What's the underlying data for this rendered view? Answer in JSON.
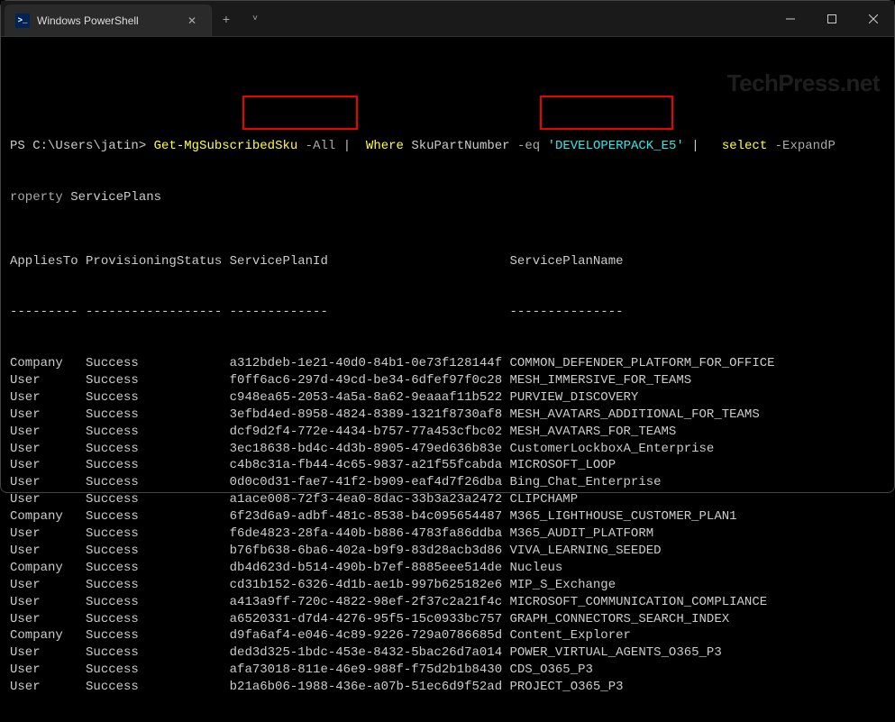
{
  "window": {
    "tab_title": "Windows PowerShell"
  },
  "watermark": "TechPress.net",
  "prompt": {
    "ps": "PS ",
    "path": "C:\\Users\\jatin> ",
    "cmd1": "Get-MgSubscribedSku",
    "flag_all": " -All ",
    "pipe1": "|",
    "where": "  Where ",
    "sku": "SkuPartNumber",
    "eq": " -eq ",
    "val": "'DEVELOPERPACK_E5'",
    "pipe2": " | ",
    "select": "  select ",
    "expand": "-ExpandP",
    "roperty": "roperty ",
    "sp": "ServicePlans"
  },
  "columns": {
    "c1": "AppliesTo",
    "c2": "ProvisioningStatus",
    "c3": "ServicePlanId",
    "c4": "ServicePlanName"
  },
  "dividers": {
    "c1": "---------",
    "c2": "------------------",
    "c3": "-------------",
    "c4": "---------------"
  },
  "rows": [
    {
      "applies": "Company",
      "status": "Success",
      "id": "a312bdeb-1e21-40d0-84b1-0e73f128144f",
      "name": "COMMON_DEFENDER_PLATFORM_FOR_OFFICE"
    },
    {
      "applies": "User",
      "status": "Success",
      "id": "f0ff6ac6-297d-49cd-be34-6dfef97f0c28",
      "name": "MESH_IMMERSIVE_FOR_TEAMS"
    },
    {
      "applies": "User",
      "status": "Success",
      "id": "c948ea65-2053-4a5a-8a62-9eaaaf11b522",
      "name": "PURVIEW_DISCOVERY"
    },
    {
      "applies": "User",
      "status": "Success",
      "id": "3efbd4ed-8958-4824-8389-1321f8730af8",
      "name": "MESH_AVATARS_ADDITIONAL_FOR_TEAMS"
    },
    {
      "applies": "User",
      "status": "Success",
      "id": "dcf9d2f4-772e-4434-b757-77a453cfbc02",
      "name": "MESH_AVATARS_FOR_TEAMS"
    },
    {
      "applies": "User",
      "status": "Success",
      "id": "3ec18638-bd4c-4d3b-8905-479ed636b83e",
      "name": "CustomerLockboxA_Enterprise"
    },
    {
      "applies": "User",
      "status": "Success",
      "id": "c4b8c31a-fb44-4c65-9837-a21f55fcabda",
      "name": "MICROSOFT_LOOP"
    },
    {
      "applies": "User",
      "status": "Success",
      "id": "0d0c0d31-fae7-41f2-b909-eaf4d7f26dba",
      "name": "Bing_Chat_Enterprise"
    },
    {
      "applies": "User",
      "status": "Success",
      "id": "a1ace008-72f3-4ea0-8dac-33b3a23a2472",
      "name": "CLIPCHAMP"
    },
    {
      "applies": "Company",
      "status": "Success",
      "id": "6f23d6a9-adbf-481c-8538-b4c095654487",
      "name": "M365_LIGHTHOUSE_CUSTOMER_PLAN1"
    },
    {
      "applies": "User",
      "status": "Success",
      "id": "f6de4823-28fa-440b-b886-4783fa86ddba",
      "name": "M365_AUDIT_PLATFORM"
    },
    {
      "applies": "User",
      "status": "Success",
      "id": "b76fb638-6ba6-402a-b9f9-83d28acb3d86",
      "name": "VIVA_LEARNING_SEEDED"
    },
    {
      "applies": "Company",
      "status": "Success",
      "id": "db4d623d-b514-490b-b7ef-8885eee514de",
      "name": "Nucleus"
    },
    {
      "applies": "User",
      "status": "Success",
      "id": "cd31b152-6326-4d1b-ae1b-997b625182e6",
      "name": "MIP_S_Exchange"
    },
    {
      "applies": "User",
      "status": "Success",
      "id": "a413a9ff-720c-4822-98ef-2f37c2a21f4c",
      "name": "MICROSOFT_COMMUNICATION_COMPLIANCE"
    },
    {
      "applies": "User",
      "status": "Success",
      "id": "a6520331-d7d4-4276-95f5-15c0933bc757",
      "name": "GRAPH_CONNECTORS_SEARCH_INDEX"
    },
    {
      "applies": "Company",
      "status": "Success",
      "id": "d9fa6af4-e046-4c89-9226-729a0786685d",
      "name": "Content_Explorer"
    },
    {
      "applies": "User",
      "status": "Success",
      "id": "ded3d325-1bdc-453e-8432-5bac26d7a014",
      "name": "POWER_VIRTUAL_AGENTS_O365_P3"
    },
    {
      "applies": "User",
      "status": "Success",
      "id": "afa73018-811e-46e9-988f-f75d2b1b8430",
      "name": "CDS_O365_P3"
    },
    {
      "applies": "User",
      "status": "Success",
      "id": "b21a6b06-1988-436e-a07b-51ec6d9f52ad",
      "name": "PROJECT_O365_P3"
    }
  ]
}
